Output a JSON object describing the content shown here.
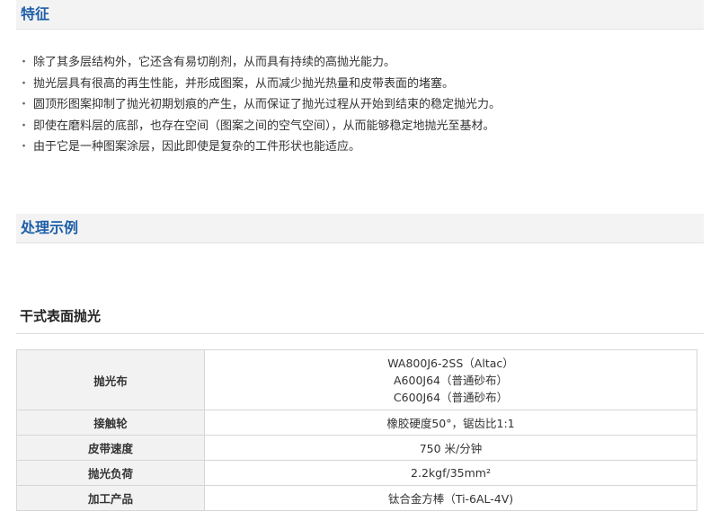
{
  "section1": {
    "title": "特征"
  },
  "features": [
    "除了其多层结构外，它还含有易切削剂，从而具有持续的高抛光能力。",
    "抛光层具有很高的再生性能，并形成图案，从而减少抛光热量和皮带表面的堵塞。",
    "圆顶形图案抑制了抛光初期划痕的产生，从而保证了抛光过程从开始到结束的稳定抛光力。",
    "即使在磨料层的底部，也存在空间（图案之间的空气空间），从而能够稳定地抛光至基材。",
    "由于它是一种图案涂层，因此即使是复杂的工件形状也能适应。"
  ],
  "bullet": "・",
  "section2": {
    "title": "处理示例"
  },
  "example": {
    "title": "干式表面抛光",
    "rows": [
      {
        "label": "抛光布",
        "values": [
          "WA800J6-2SS（Altac）",
          "A600J64（普通砂布）",
          "C600J64（普通砂布）"
        ]
      },
      {
        "label": "接触轮",
        "values": [
          "橡胶硬度50°，锯齿比1:1"
        ]
      },
      {
        "label": "皮带速度",
        "values": [
          "750 米/分钟"
        ]
      },
      {
        "label": "抛光负荷",
        "values": [
          "2.2kgf/35mm²"
        ]
      },
      {
        "label": "加工产品",
        "values": [
          "钛合金方棒（Ti-6AL-4V)"
        ]
      }
    ]
  }
}
